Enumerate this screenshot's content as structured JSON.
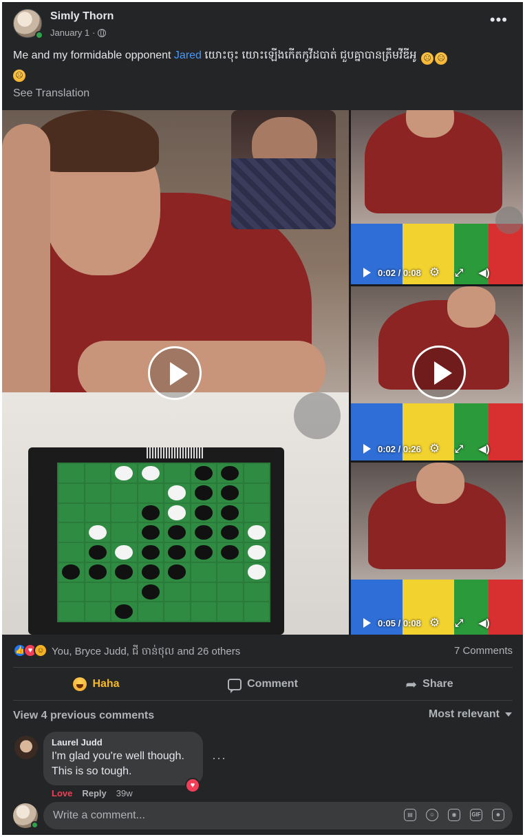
{
  "post": {
    "author": "Simly Thorn",
    "date": "January 1",
    "date_sep": "·",
    "text_before": "Me and my formidable opponent ",
    "tagged": "Jared",
    "text_after": " យោះចុះ យោះឡើងកើតកូវីដបាត់ ជួបគ្នាបានត្រឹមវីឌីអូ",
    "see_translation": "See Translation",
    "more_icon": "more-horizontal-icon"
  },
  "videos": {
    "side": [
      {
        "time": "0:02 / 0:08"
      },
      {
        "time": "0:02 / 0:26"
      },
      {
        "time": "0:05 / 0:08"
      }
    ]
  },
  "reactions": {
    "icons": [
      "like-icon",
      "love-icon",
      "haha-icon"
    ],
    "names": "You, Bryce Judd, ជី ចាន់ថុល and 26 others",
    "comments_count": "7 Comments"
  },
  "actions": {
    "haha": "Haha",
    "comment": "Comment",
    "share": "Share"
  },
  "comments": {
    "view_previous": "View 4 previous comments",
    "sort": "Most relevant",
    "items": [
      {
        "author": "Laurel Judd",
        "line1": "I'm glad you're well though.",
        "line2": "This is so tough.",
        "love": "Love",
        "reply": "Reply",
        "time": "39w"
      }
    ],
    "input_placeholder": "Write a comment...",
    "input_icons": [
      "sticker-icon",
      "emoji-icon",
      "camera-icon",
      "gif-icon",
      "avatar-sticker-icon"
    ]
  },
  "colors": {
    "background": "#242526",
    "link": "#4599ff",
    "haha_active": "#f7b928",
    "love": "#f33e58",
    "online": "#31a24c"
  }
}
